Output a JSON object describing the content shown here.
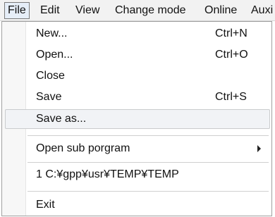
{
  "menubar": {
    "items": [
      {
        "label": "File",
        "active": true
      },
      {
        "label": "Edit"
      },
      {
        "label": "View"
      },
      {
        "label": "Change mode"
      },
      {
        "label": "Online"
      },
      {
        "label": "Auxi"
      }
    ]
  },
  "file_menu": {
    "items": [
      {
        "label": "New...",
        "shortcut": "Ctrl+N"
      },
      {
        "label": "Open...",
        "shortcut": "Ctrl+O"
      },
      {
        "label": "Close"
      },
      {
        "label": "Save",
        "shortcut": "Ctrl+S"
      },
      {
        "label": "Save as...",
        "highlighted": true
      },
      {
        "label": "Open sub porgram",
        "has_submenu": true
      },
      {
        "label": "1 C:¥gpp¥usr¥TEMP¥TEMP"
      },
      {
        "label": "Exit"
      }
    ],
    "submenu_arrow_icon": "chevron-right-icon"
  }
}
